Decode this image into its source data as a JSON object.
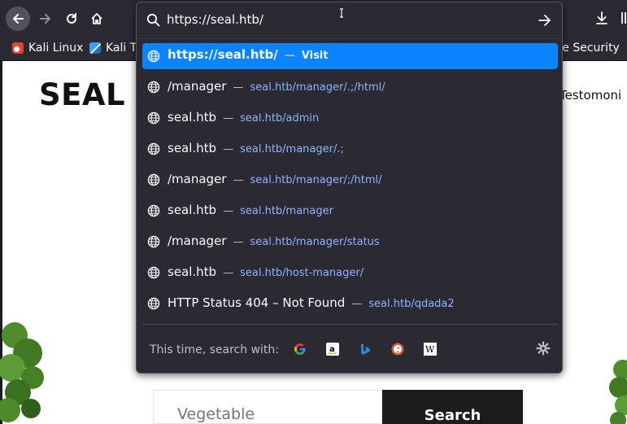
{
  "toolbar": {
    "url_value": "https://seal.htb/",
    "back_icon": "arrow-left-icon",
    "forward_icon": "arrow-right-icon",
    "reload_icon": "reload-icon",
    "home_icon": "home-icon"
  },
  "bookmarks": [
    {
      "label": "Kali Linux",
      "icon": "kali-icon"
    },
    {
      "label": "Kali T",
      "icon": "kali-tools-icon"
    },
    {
      "label": "ve Security",
      "icon": ""
    }
  ],
  "page": {
    "title": "SEAL M",
    "nav_link": "Testomoni",
    "search_placeholder": "Vegetable",
    "search_button": "Search"
  },
  "urlbar": {
    "go_icon": "arrow-right-icon",
    "results": [
      {
        "title": "https://seal.htb/",
        "desc": "Visit",
        "selected": true
      },
      {
        "title": "/manager",
        "desc": "seal.htb/manager/.;/html/"
      },
      {
        "title": "seal.htb",
        "desc": "seal.htb/admin"
      },
      {
        "title": "seal.htb",
        "desc": "seal.htb/manager/.;"
      },
      {
        "title": "/manager",
        "desc": "seal.htb/manager/;/html/"
      },
      {
        "title": "seal.htb",
        "desc": "seal.htb/manager"
      },
      {
        "title": "/manager",
        "desc": "seal.htb/manager/status"
      },
      {
        "title": "seal.htb",
        "desc": "seal.htb/host-manager/"
      },
      {
        "title": "HTTP Status 404 – Not Found",
        "desc": "seal.htb/qdada2"
      }
    ],
    "separator": "—",
    "oneoffs_label": "This time, search with:",
    "engines": [
      "google-icon",
      "amazon-icon",
      "bing-icon",
      "duckduckgo-icon",
      "wikipedia-icon"
    ]
  },
  "colors": {
    "accent": "#0a84ff",
    "chrome": "#2b2a33",
    "popup_border": "#57575f",
    "link_blue": "#8cb4ff"
  }
}
